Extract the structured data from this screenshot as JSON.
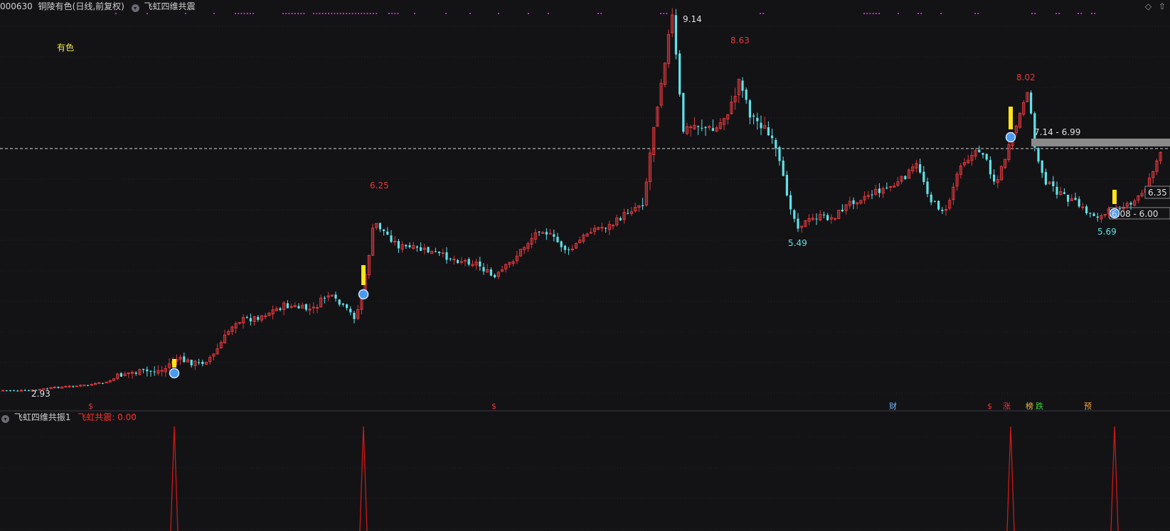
{
  "header": {
    "code": "000630",
    "title": "铜陵有色(日线,前复权)",
    "indicator": "飞虹四维共震"
  },
  "stock_label": "有色",
  "sub_header": {
    "indicator": "飞虹四维共振1",
    "value_label": "飞虹共震: 0.00"
  },
  "icons": {
    "top_right_1": "diamond-icon",
    "top_right_2": "arrow-up-icon"
  },
  "colors": {
    "up": "#e0373c",
    "down": "#5fe2e8",
    "signal": "#ffe41a",
    "peak": "#d01818",
    "marker": "#d020d0"
  },
  "chart_data": {
    "type": "candlestick",
    "annotations": {
      "high_1": "6.25",
      "high_2": "9.14",
      "high_3": "8.63",
      "high_4": "8.02",
      "low_0": "2.93",
      "low_1": "5.49",
      "low_2": "5.69",
      "zone_1": "7.14 - 6.99",
      "zone_2": "6.08 - 6.00",
      "current": "6.35"
    },
    "event_labels": [
      "$",
      "$",
      "财",
      "$",
      "涨",
      "榜",
      "跌",
      "预"
    ],
    "sub_series": {
      "name": "飞虹共震",
      "peaks_at_signal_indices": [
        1,
        2,
        3,
        4
      ]
    }
  }
}
